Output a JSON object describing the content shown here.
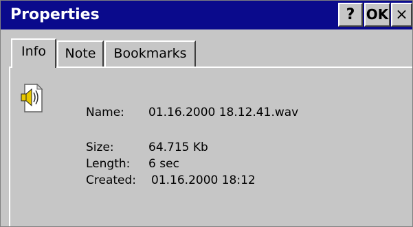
{
  "window": {
    "title": "Properties"
  },
  "titlebar_buttons": {
    "help": "?",
    "ok": "OK",
    "close": "×"
  },
  "tabs": [
    {
      "label": "Info",
      "selected": true
    },
    {
      "label": "Note",
      "selected": false
    },
    {
      "label": "Bookmarks",
      "selected": false
    }
  ],
  "info": {
    "icon": "audio-file-icon",
    "name_label": "Name:",
    "name_value": "01.16.2000 18.12.41.wav",
    "size_label": "Size:",
    "size_value": "64.715 Kb",
    "length_label": "Length:",
    "length_value": "6 sec",
    "created_label": "Created:",
    "created_value": "01.16.2000 18:12"
  },
  "colors": {
    "titlebar": "#0a0a8c",
    "face": "#c6c6c6"
  }
}
